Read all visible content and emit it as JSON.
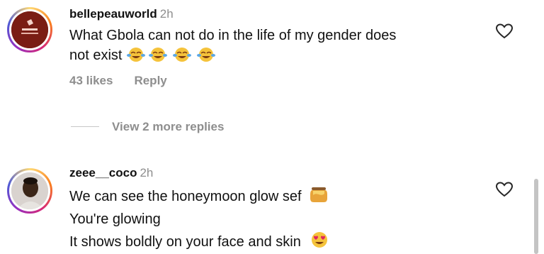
{
  "comments": [
    {
      "username": "bellepeauworld",
      "time": "2h",
      "lines": [
        "What Gbola can not do in the life of my gender does",
        "not exist"
      ],
      "emoji_icons": [
        "joy-emoji",
        "joy-emoji",
        "joy-emoji",
        "joy-emoji"
      ],
      "likes": "43 likes",
      "reply": "Reply"
    },
    {
      "username": "zeee__coco",
      "time": "2h",
      "lines": [
        "We can see the honeymoon glow sef",
        "You're glowing",
        "It shows boldly on your face and skin"
      ],
      "emoji_icons": [
        "honey-pot-emoji",
        "heart-eyes-emoji"
      ]
    }
  ],
  "view_replies": "View 2 more replies",
  "colors": {
    "text": "#111111",
    "muted": "#8e8e8e",
    "divider": "#c7c7c7"
  }
}
